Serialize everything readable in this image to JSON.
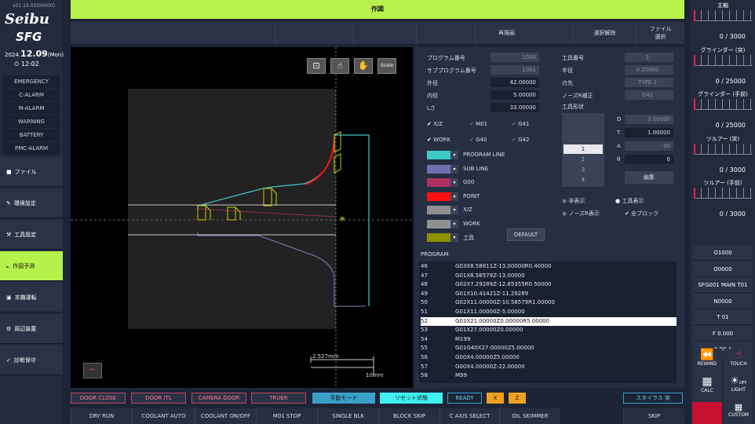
{
  "version": "v01.13.02(00000)",
  "logo": {
    "line1": "Seibu",
    "line2": "SFG"
  },
  "date": {
    "year": "2024.",
    "md": "12.09",
    "dow": "(Mon)"
  },
  "time": "12:02",
  "alarms": [
    "EMERGENCY",
    "C-ALARM",
    "M-ALARM",
    "WARNING",
    "BATTERY",
    "PMC-ALARM"
  ],
  "nav": [
    {
      "label": "ファイル",
      "icon": "■"
    },
    {
      "label": "環境設定",
      "icon": "✎"
    },
    {
      "label": "工具設定",
      "icon": "⚒"
    },
    {
      "label": "作図予測",
      "icon": "⟀"
    },
    {
      "label": "本機運転",
      "icon": "▣"
    },
    {
      "label": "周辺装置",
      "icon": "⚙"
    },
    {
      "label": "診断保守",
      "icon": "✓"
    }
  ],
  "title": "作図",
  "toolbar": {
    "redraw": "再描画",
    "deselect": "選択解除",
    "file_select_1": "ファイル",
    "file_select_2": "選択"
  },
  "draw": {
    "scale_val": "2.527mm",
    "scale_unit": "10mm",
    "zoom_label": "Scale"
  },
  "params_left": [
    {
      "label": "プログラム番号",
      "value": "1000",
      "dim": true
    },
    {
      "label": "サブプログラム番号",
      "value": "1001",
      "dim": true
    },
    {
      "label": "外径",
      "value": "42.00000",
      "dim": false
    },
    {
      "label": "内径",
      "value": "5.00000",
      "dim": false
    },
    {
      "label": "Lさ",
      "value": "33.00000",
      "dim": false
    }
  ],
  "params_right": [
    {
      "label": "工具番号",
      "value": "1"
    },
    {
      "label": "半径",
      "value": "0.20000"
    },
    {
      "label": "刃先",
      "value": "TYPE 2"
    },
    {
      "label": "ノーズR補正",
      "value": "G42"
    }
  ],
  "tool_shape_label": "工具形状",
  "tool_list": [
    "1",
    "2",
    "3",
    "4"
  ],
  "tool_dims": [
    {
      "label": "D",
      "value": "3.00000"
    },
    {
      "label": "T",
      "value": "1.00000"
    },
    {
      "label": "A",
      "value": "90"
    },
    {
      "label": "θ",
      "value": "0"
    }
  ],
  "edit_label": "編集",
  "checks": [
    {
      "label": "X/Z",
      "on": true
    },
    {
      "label": "M01",
      "on": false
    },
    {
      "label": "G41",
      "on": false
    },
    {
      "label": "WORK",
      "on": true
    },
    {
      "label": "G40",
      "on": false
    },
    {
      "label": "G42",
      "on": false
    }
  ],
  "colors": [
    {
      "label": "PROGRAM LINE",
      "color": "#3fc8c8"
    },
    {
      "label": "SUB LINE",
      "color": "#7070b0"
    },
    {
      "label": "G00",
      "color": "#b03060"
    },
    {
      "label": "POINT",
      "color": "#ff1010"
    },
    {
      "label": "X/Z",
      "color": "#909090"
    },
    {
      "label": "WORK",
      "color": "#909090"
    },
    {
      "label": "工具",
      "color": "#909000"
    }
  ],
  "default_label": "DEFAULT",
  "radios": [
    {
      "label": "非表示",
      "on": false
    },
    {
      "label": "工具表示",
      "on": true
    },
    {
      "label": "ノーズR表示",
      "on": false
    }
  ],
  "all_block": "全ブロック",
  "program_title": "PROGRAM",
  "program": [
    {
      "n": "46",
      "code": "G03X8.58811Z-13.00000R0.40000"
    },
    {
      "n": "47",
      "code": "G01X8.58579Z-13.00000"
    },
    {
      "n": "48",
      "code": "G02X7.29289Z-12.85355R0.50000"
    },
    {
      "n": "49",
      "code": "G01X10.41421Z-11.29289"
    },
    {
      "n": "50",
      "code": "G02X11.00000Z-10.58579R1.00000"
    },
    {
      "n": "51",
      "code": "G01X11.00000Z-5.00000"
    },
    {
      "n": "52",
      "code": "G03X21.00000Z0.00000R5.00000",
      "sel": true
    },
    {
      "n": "53",
      "code": "G01X27.00000Z0.00000"
    },
    {
      "n": "54",
      "code": "M199"
    },
    {
      "n": "55",
      "code": "G01G40X27.00000Z5.00000"
    },
    {
      "n": "56",
      "code": "G00X4.00000Z5.00000"
    },
    {
      "n": "57",
      "code": "G00X4.00000Z-22.00000"
    },
    {
      "n": "58",
      "code": "M99"
    }
  ],
  "bottom1": [
    "DOOR CLOSE",
    "DOOR ITL",
    "CAMERA DOOR",
    "TRUER"
  ],
  "bottom1b": {
    "manual": "手動モード",
    "reset": "リセット状態",
    "ready": "READY",
    "x": "X",
    "z": "Z",
    "stylus": "スタイラス 突"
  },
  "bottom2": [
    "DRY RUN",
    "COOLANT AUTO",
    "COOLANT ON/OFF",
    "M01 STOP",
    "SINGLE BLK",
    "BLOCK SKIP",
    "C AXIS SELECT",
    "OIL SKIMMER",
    "SKIP"
  ],
  "gauges": [
    {
      "label": "主軸",
      "value": "0 /  3000",
      "max": 3000
    },
    {
      "label": "グラインダー (突)",
      "value": "0 / 25000",
      "max": 25000
    },
    {
      "label": "グラインダー (手前)",
      "value": "0 / 25000",
      "max": 25000
    },
    {
      "label": "ツルアー (突)",
      "value": "0 /  3000",
      "max": 3000
    },
    {
      "label": "ツルアー (手前)",
      "value": "0 /  3000",
      "max": 3000
    }
  ],
  "status": [
    "O1000",
    "O0000",
    "SFG001 MAIN T01",
    "N0000",
    "T 01",
    "F 0.000",
    "0.00 A"
  ],
  "icons": {
    "rewind": "REWIND",
    "touch": "TOUCH",
    "calc": "CALC",
    "light": "LIGHT",
    "custom": "CUSTOM",
    "off": "OFF"
  }
}
